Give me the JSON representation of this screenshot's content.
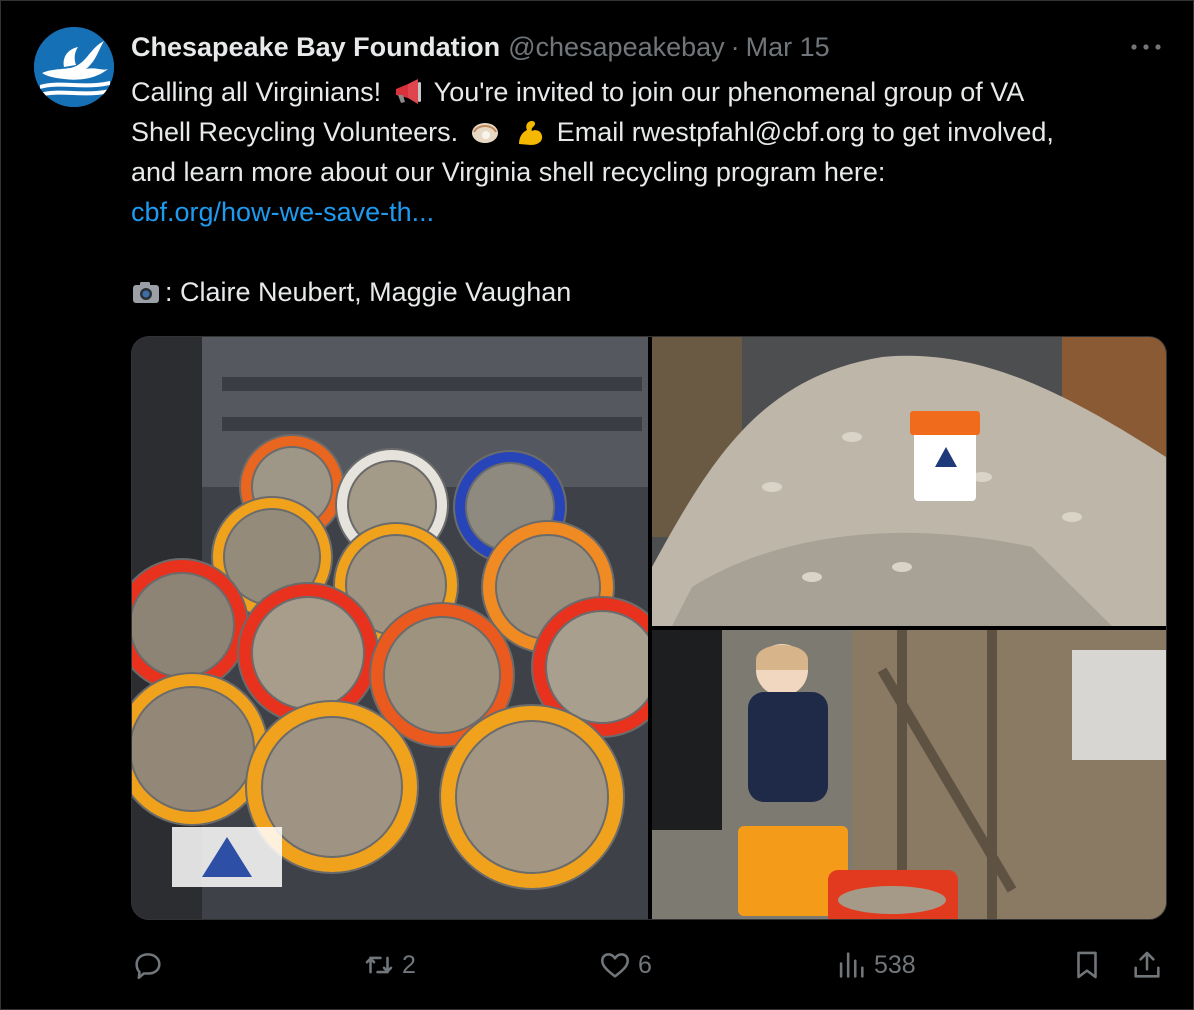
{
  "tweet": {
    "author_name": "Chesapeake Bay Foundation",
    "handle": "@chesapeakebay",
    "separator": "·",
    "date": "Mar 15",
    "text_line1_a": "Calling all Virginians!",
    "text_line1_b": "You're invited to join our phenomenal group of VA",
    "text_line2_a": "Shell Recycling Volunteers.",
    "text_line2_b": "Email rwestpfahl@cbf.org to get involved,",
    "text_line3": "and learn more about our Virginia shell recycling program here:",
    "link": "cbf.org/how-we-save-th...",
    "credit": ": Claire Neubert, Maggie Vaughan"
  },
  "icons": {
    "megaphone": "megaphone-icon",
    "oyster": "oyster-icon",
    "flexed_biceps": "flexed-biceps-icon",
    "camera": "camera-icon"
  },
  "media": {
    "photos": [
      "buckets-in-truck-bed",
      "shell-pile-with-bucket",
      "child-with-bucket"
    ]
  },
  "actions": {
    "replies": "",
    "reposts": "2",
    "likes": "6",
    "views": "538"
  },
  "colors": {
    "background": "#000000",
    "text": "#e7e9ea",
    "muted": "#71767b",
    "link": "#1d9bf0",
    "border": "#333333"
  }
}
